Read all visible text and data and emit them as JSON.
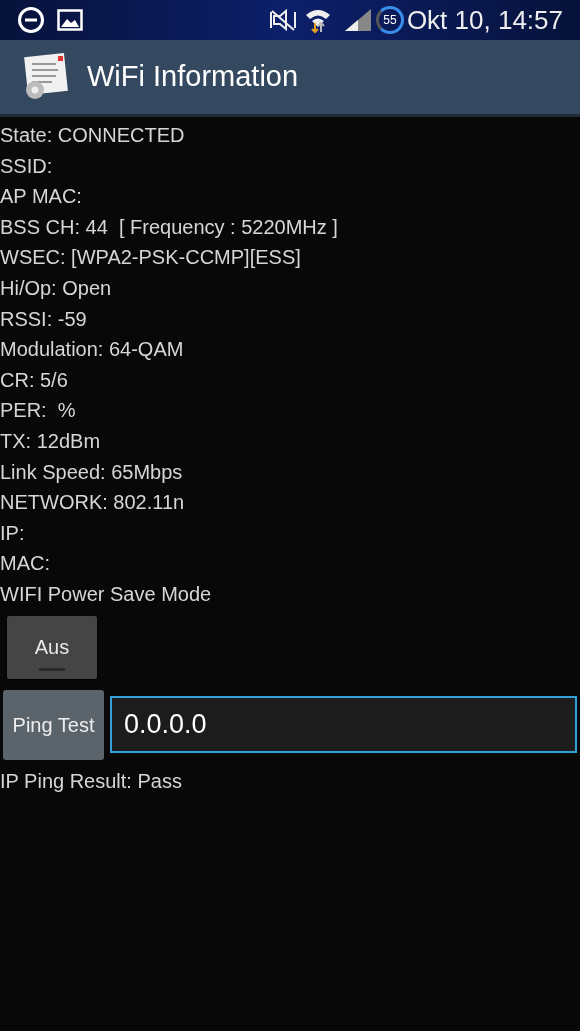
{
  "status_bar": {
    "badge": "55",
    "time": "Okt 10, 14:57"
  },
  "action_bar": {
    "title": "WiFi Information"
  },
  "info_lines": [
    "State: CONNECTED",
    "SSID:",
    "AP MAC:",
    "BSS CH: 44  [ Frequency : 5220MHz ]",
    "WSEC: [WPA2-PSK-CCMP][ESS]",
    "Hi/Op: Open",
    "RSSI: -59",
    "Modulation: 64-QAM",
    "CR: 5/6",
    "PER:  %",
    "TX: 12dBm",
    "Link Speed: 65Mbps",
    "NETWORK: 802.11n",
    "IP:",
    "MAC:",
    "WIFI Power Save Mode"
  ],
  "power_save_toggle": {
    "label": "Aus",
    "on": false
  },
  "ping_button": {
    "label": "Ping Test"
  },
  "ping_field": {
    "value": "0.0.0.0"
  },
  "ping_result": "IP Ping Result: Pass"
}
